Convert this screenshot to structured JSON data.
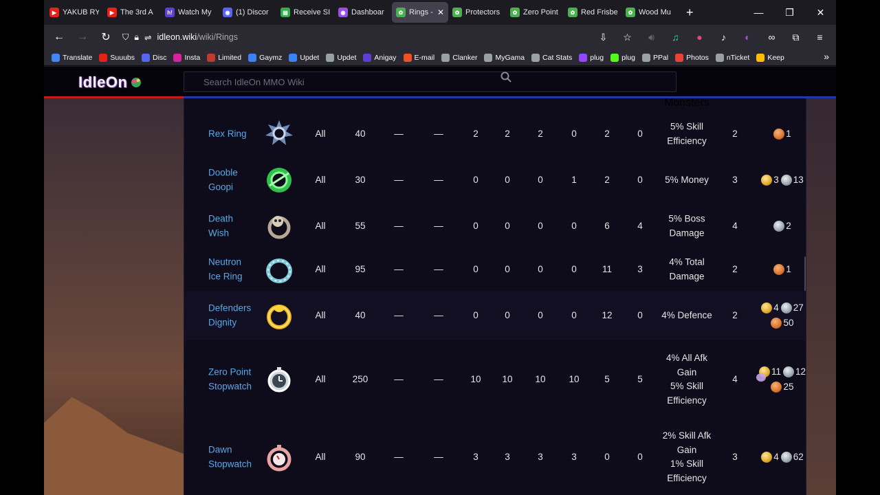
{
  "browser": {
    "tabs": [
      {
        "title": "YAKUB RY",
        "color": "#e62117",
        "glyph": "▶"
      },
      {
        "title": "The 3rd A",
        "color": "#e62117",
        "glyph": "▶"
      },
      {
        "title": "Watch My",
        "color": "#5d3fd3",
        "glyph": "h!"
      },
      {
        "title": "(1) Discor",
        "color": "#5865f2",
        "glyph": "◉"
      },
      {
        "title": "Receive SI",
        "color": "#2fb04a",
        "glyph": "▤"
      },
      {
        "title": "Dashboar",
        "color": "#9b4fe0",
        "glyph": "◉"
      },
      {
        "title": "Rings -",
        "color": "#4caf50",
        "glyph": "✿",
        "active": true
      },
      {
        "title": "Protectors",
        "color": "#4caf50",
        "glyph": "✿"
      },
      {
        "title": "Zero Point",
        "color": "#4caf50",
        "glyph": "✿"
      },
      {
        "title": "Red Frisbe",
        "color": "#4caf50",
        "glyph": "✿"
      },
      {
        "title": "Wood Mu",
        "color": "#4caf50",
        "glyph": "✿"
      }
    ],
    "url_host": "idleon.wiki",
    "url_path": "/wiki/Rings",
    "bookmarks": [
      {
        "label": "Translate",
        "color": "#4285f4"
      },
      {
        "label": "Suuubs",
        "color": "#e62117"
      },
      {
        "label": "Disc",
        "color": "#5865f2"
      },
      {
        "label": "Insta",
        "color": "#d6249f"
      },
      {
        "label": "Limited",
        "color": "#c0392b"
      },
      {
        "label": "Gaymz",
        "color": "#3b82f6"
      },
      {
        "label": "Updet",
        "color": "#3b82f6"
      },
      {
        "label": "Updet",
        "color": "#9aa0a6"
      },
      {
        "label": "Anigay",
        "color": "#5d3fd3"
      },
      {
        "label": "E-mail",
        "color": "#f25022"
      },
      {
        "label": "Clanker",
        "color": "#9aa0a6"
      },
      {
        "label": "MyGama",
        "color": "#9aa0a6"
      },
      {
        "label": "Cat Stats",
        "color": "#9aa0a6"
      },
      {
        "label": "plug",
        "color": "#9146ff"
      },
      {
        "label": "plug",
        "color": "#53fc18"
      },
      {
        "label": "PPal",
        "color": "#9aa0a6"
      },
      {
        "label": "Photos",
        "color": "#ea4335"
      },
      {
        "label": "nTicket",
        "color": "#9aa0a6"
      },
      {
        "label": "Keep",
        "color": "#fbbc04"
      }
    ]
  },
  "site": {
    "logo": "IdleOn",
    "search_placeholder": "Search IdleOn MMO Wiki"
  },
  "table": {
    "partial_top": "Monsters",
    "rows": [
      {
        "name": [
          "Rex Ring"
        ],
        "class": "All",
        "lvl": "40",
        "c1": "—",
        "c2": "—",
        "s1": "2",
        "s2": "2",
        "s3": "2",
        "s4": "0",
        "s5": "2",
        "s6": "0",
        "effect": [
          "5% Skill",
          "Efficiency"
        ],
        "slots": "2",
        "cost": [
          {
            "coin": "copper",
            "n": "1"
          }
        ],
        "icon": "rex"
      },
      {
        "name": [
          "Dooble",
          "Goopi"
        ],
        "class": "All",
        "lvl": "30",
        "c1": "—",
        "c2": "—",
        "s1": "0",
        "s2": "0",
        "s3": "0",
        "s4": "1",
        "s5": "2",
        "s6": "0",
        "effect": [
          "5% Money"
        ],
        "slots": "3",
        "cost": [
          {
            "coin": "gold",
            "n": "3"
          },
          {
            "coin": "silver",
            "n": "13"
          }
        ],
        "icon": "goopi"
      },
      {
        "name": [
          "Death",
          "Wish"
        ],
        "class": "All",
        "lvl": "55",
        "c1": "—",
        "c2": "—",
        "s1": "0",
        "s2": "0",
        "s3": "0",
        "s4": "0",
        "s5": "6",
        "s6": "4",
        "effect": [
          "5% Boss",
          "Damage"
        ],
        "slots": "4",
        "cost": [
          {
            "coin": "silver",
            "n": "2"
          }
        ],
        "icon": "skull"
      },
      {
        "name": [
          "Neutron",
          "Ice Ring"
        ],
        "class": "All",
        "lvl": "95",
        "c1": "—",
        "c2": "—",
        "s1": "0",
        "s2": "0",
        "s3": "0",
        "s4": "0",
        "s5": "11",
        "s6": "3",
        "effect": [
          "4% Total",
          "Damage"
        ],
        "slots": "2",
        "cost": [
          {
            "coin": "copper",
            "n": "1"
          }
        ],
        "icon": "ice"
      },
      {
        "name": [
          "Defenders",
          "Dignity"
        ],
        "class": "All",
        "lvl": "40",
        "c1": "—",
        "c2": "—",
        "s1": "0",
        "s2": "0",
        "s3": "0",
        "s4": "0",
        "s5": "12",
        "s6": "0",
        "effect": [
          "4% Defence"
        ],
        "slots": "2",
        "cost": [
          {
            "coin": "gold",
            "n": "4"
          },
          {
            "coin": "silver",
            "n": "27"
          },
          {
            "coin": "copper",
            "n": "50"
          }
        ],
        "icon": "gold",
        "hl": true
      },
      {
        "name": [
          "Zero Point",
          "Stopwatch"
        ],
        "class": "All",
        "lvl": "250",
        "c1": "—",
        "c2": "—",
        "s1": "10",
        "s2": "10",
        "s3": "10",
        "s4": "10",
        "s5": "5",
        "s6": "5",
        "effect": [
          "4% All Afk",
          "Gain",
          "5% Skill",
          "Efficiency"
        ],
        "slots": "4",
        "cost": [
          {
            "coin": "gold",
            "n": "11"
          },
          {
            "coin": "silver",
            "n": "12"
          },
          {
            "coin": "copper",
            "n": "25"
          }
        ],
        "icon": "watch"
      },
      {
        "name": [
          "Dawn",
          "Stopwatch"
        ],
        "class": "All",
        "lvl": "90",
        "c1": "—",
        "c2": "—",
        "s1": "3",
        "s2": "3",
        "s3": "3",
        "s4": "3",
        "s5": "0",
        "s6": "0",
        "effect": [
          "2% Skill Afk",
          "Gain",
          "1% Skill",
          "Efficiency"
        ],
        "slots": "3",
        "cost": [
          {
            "coin": "gold",
            "n": "4"
          },
          {
            "coin": "silver",
            "n": "62"
          }
        ],
        "icon": "dawn"
      }
    ]
  }
}
